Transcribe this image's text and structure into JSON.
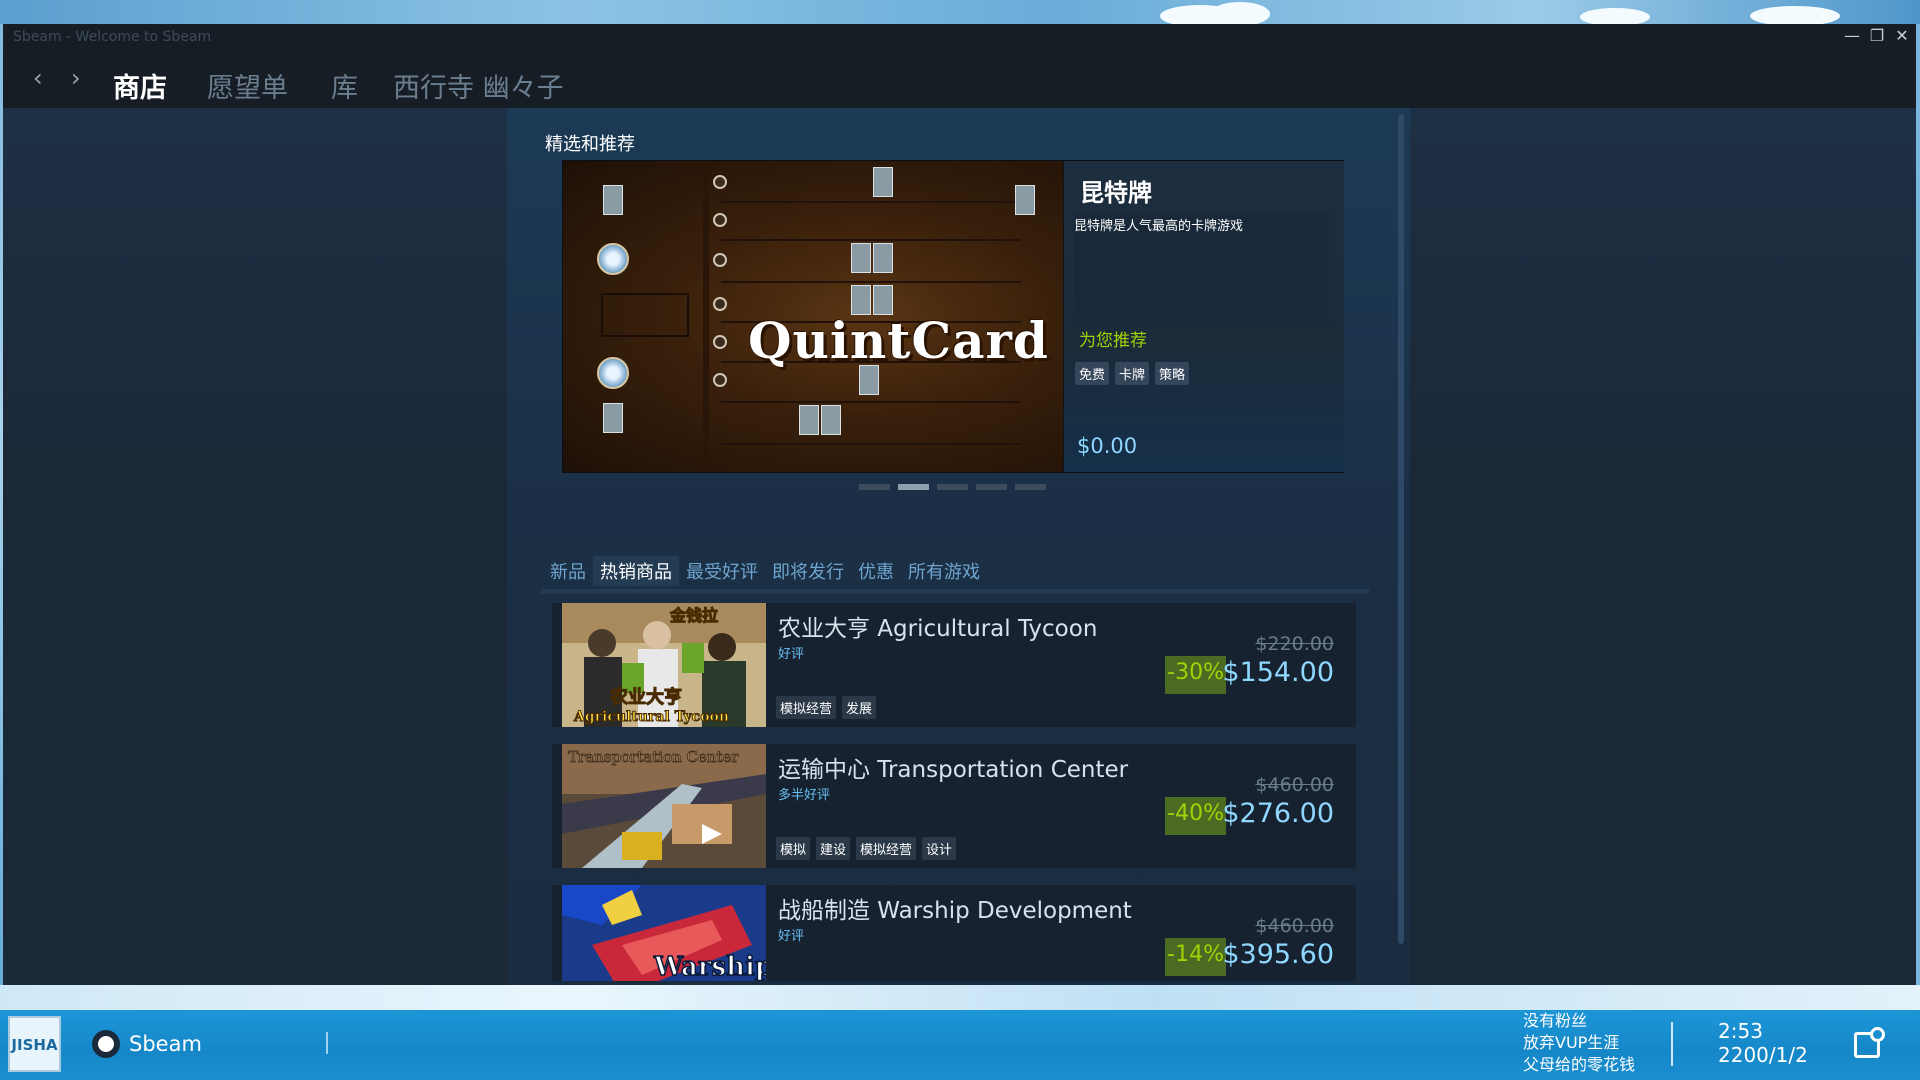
{
  "window": {
    "title": "Sbeam - Welcome to Sbeam",
    "controls": [
      "minimize",
      "restore",
      "close"
    ]
  },
  "nav": {
    "back_glyph": "‹",
    "forward_glyph": "›",
    "tabs": [
      "商店",
      "愿望单",
      "库",
      "西行寺 幽々子"
    ],
    "active_tab": "商店"
  },
  "featured": {
    "section_title": "精选和推荐",
    "capsule_logo": "QuintCard",
    "title": "昆特牌",
    "description": "昆特牌是人气最高的卡牌游戏",
    "recommend_label": "为您推荐",
    "tags": [
      "免费",
      "卡牌",
      "策略"
    ],
    "price": "$0.00",
    "carousel_pages": 5,
    "carousel_active": 2
  },
  "tabs": {
    "items": [
      "新品",
      "热销商品",
      "最受好评",
      "即将发行",
      "优惠",
      "所有游戏"
    ],
    "active": "热销商品"
  },
  "products": [
    {
      "name": "农业大亨 Agricultural Tycoon",
      "review": "好评",
      "tags": [
        "模拟经营",
        "发展"
      ],
      "original_price": "$220.00",
      "discount": "-30%",
      "final_price": "$154.00"
    },
    {
      "name": "运输中心 Transportation Center",
      "review": "多半好评",
      "tags": [
        "模拟",
        "建设",
        "模拟经营",
        "设计"
      ],
      "original_price": "$460.00",
      "discount": "-40%",
      "final_price": "$276.00"
    },
    {
      "name": "战船制造 Warship Development",
      "review": "好评",
      "tags": [],
      "original_price": "$460.00",
      "discount": "-14%",
      "final_price": "$395.60"
    }
  ],
  "thumbnail_text": {
    "tycoon_top": "金钱拉",
    "tycoon_bottom": "Agricultural Tycoon",
    "tycoon_cn": "农业大亨",
    "transport": "Transportation Center",
    "warship": "Warship"
  },
  "taskbar": {
    "start_label": "JISHA OS",
    "app_label": "Sbeam",
    "notes": [
      "没有粉丝",
      "放弃VUP生涯",
      "父母给的零花钱"
    ],
    "time": "2:53",
    "date": "2200/1/2"
  },
  "colors": {
    "accent_green": "#a4d007",
    "price_blue": "#8fd7ff",
    "discount_bg": "#4c6b22",
    "window_bg": "#1b2838",
    "taskbar": "#1a8fcf"
  }
}
